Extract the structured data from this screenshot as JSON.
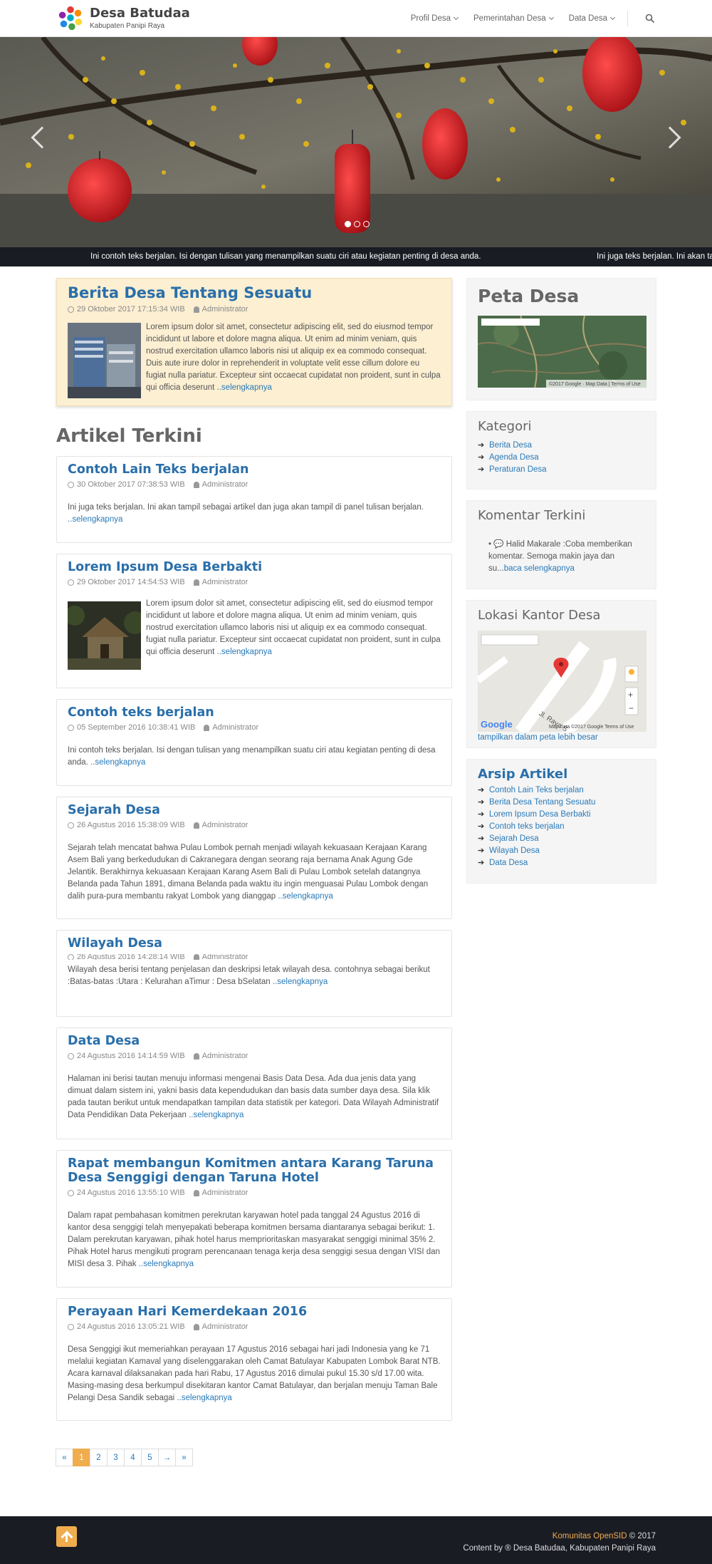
{
  "header": {
    "title": "Desa Batudaa",
    "subtitle": "Kabupaten Panipi Raya",
    "nav": [
      {
        "label": "Profil Desa"
      },
      {
        "label": "Pemerintahan Desa"
      },
      {
        "label": "Data Desa"
      }
    ],
    "search_icon": "search-icon"
  },
  "slider": {
    "dots": 3,
    "active": 0
  },
  "ticker": {
    "text1": "Ini contoh teks berjalan. Isi dengan tulisan yang menampilkan suatu ciri atau kegiatan penting di desa anda.",
    "text2": "Ini juga teks berjalan. Ini akan tampil sebagai artikel dan juga akan tampil di panel tulisan berjalan."
  },
  "featured": {
    "title": "Berita Desa Tentang Sesuatu",
    "date": "29 Oktober 2017 17:15:34 WIB",
    "author": "Administrator",
    "excerpt": "Lorem ipsum dolor sit amet, consectetur adipiscing elit, sed do eiusmod tempor incididunt ut labore et dolore magna aliqua. Ut enim ad minim veniam, quis nostrud exercitation ullamco laboris nisi ut aliquip ex ea commodo consequat. Duis aute irure dolor in reprehenderit in voluptate velit esse cillum dolore eu fugiat nulla pariatur. Excepteur sint occaecat cupidatat non proident, sunt in culpa qui officia deserunt ",
    "more": "..selengkapnya"
  },
  "articles_title": "Artikel Terkini",
  "posts": [
    {
      "title": "Contoh Lain Teks berjalan",
      "date": "30 Oktober 2017 07:38:53 WIB",
      "author": "Administrator",
      "excerpt": "Ini juga teks berjalan. Ini akan tampil sebagai artikel dan juga akan tampil di panel tulisan berjalan. ",
      "more": "..selengkapnya"
    },
    {
      "title": "Lorem Ipsum Desa Berbakti",
      "date": "29 Oktober 2017 14:54:53 WIB",
      "author": "Administrator",
      "excerpt": "Lorem ipsum dolor sit amet, consectetur adipiscing elit, sed do eiusmod tempor incididunt ut labore et dolore magna aliqua. Ut enim ad minim veniam, quis nostrud exercitation ullamco laboris nisi ut aliquip ex ea commodo consequat. fugiat nulla pariatur. Excepteur sint occaecat cupidatat non proident, sunt in culpa qui officia deserunt ",
      "more": "..selengkapnya"
    },
    {
      "title": "Contoh teks berjalan",
      "date": "05 September 2016 10:38:41 WIB",
      "author": "Administrator",
      "excerpt": "Ini contoh teks berjalan. Isi dengan tulisan yang menampilkan suatu ciri atau kegiatan penting di desa anda. ",
      "more": "..selengkapnya"
    },
    {
      "title": "Sejarah Desa",
      "date": "26 Agustus 2016 15:38:09 WIB",
      "author": "Administrator",
      "excerpt": "Sejarah telah mencatat bahwa Pulau Lombok pernah menjadi wilayah kekuasaan Kerajaan Karang Asem Bali yang berkedudukan di Cakranegara dengan seorang raja bernama Anak Agung Gde Jelantik. Berakhirnya kekuasaan Kerajaan Karang Asem Bali di Pulau Lombok setelah datangnya Belanda pada Tahun 1891, dimana Belanda pada waktu itu ingin menguasai Pulau Lombok dengan dalih pura-pura membantu rakyat Lombok yang dianggap ",
      "more": "..selengkapnya"
    },
    {
      "title": "Wilayah Desa",
      "date": "26 Agustus 2016 14:28:14 WIB",
      "author": "Administrator",
      "excerpt": "Wilayah desa berisi tentang penjelasan dan deskripsi letak wilayah desa. contohnya sebagai berikut :Batas-batas :Utara : Kelurahan aTimur : Desa bSelatan ",
      "more": "..selengkapnya"
    },
    {
      "title": "Data Desa",
      "date": "24 Agustus 2016 14:14:59 WIB",
      "author": "Administrator",
      "excerpt": "Halaman ini berisi tautan menuju informasi mengenai Basis Data Desa. Ada dua jenis data yang dimuat dalam sistem ini, yakni basis data kependudukan dan basis data sumber daya desa. Sila klik pada tautan berikut untuk mendapatkan tampilan data statistik per kategori. Data Wilayah Administratif Data Pendidikan Data Pekerjaan ",
      "more": "..selengkapnya"
    },
    {
      "title": "Rapat membangun Komitmen antara Karang Taruna Desa Senggigi dengan Taruna Hotel",
      "date": "24 Agustus 2016 13:55:10 WIB",
      "author": "Administrator",
      "excerpt": "Dalam rapat pembahasan komitmen perekrutan karyawan hotel pada tanggal 24 Agustus 2016 di kantor desa senggigi telah menyepakati beberapa komitmen bersama diantaranya sebagai berikut: 1. Dalam perekrutan karyawan, pihak hotel harus memprioritaskan masyarakat senggigi minimal 35% 2. Pihak Hotel harus mengikuti program perencanaan tenaga kerja desa senggigi sesua dengan VISI dan MISI desa 3. Pihak ",
      "more": "..selengkapnya"
    },
    {
      "title": "Perayaan Hari Kemerdekaan 2016",
      "date": "24 Agustus 2016 13:05:21 WIB",
      "author": "Administrator",
      "excerpt": "Desa Senggigi ikut memeriahkan perayaan 17 Agustus 2016 sebagai hari jadi Indonesia yang ke 71 melalui kegiatan Kamaval yang diselenggarakan oleh Camat Batulayar Kabupaten Lombok Barat NTB. Acara karnaval dilaksanakan pada hari Rabu, 17 Agustus 2016 dimulai pukul 15.30 s/d 17.00 wita. Masing-masing desa berkumpul disekitaran kantor Camat Batulayar, dan berjalan menuju Taman Bale Pelangi Desa Sandik sebagai ",
      "more": "..selengkapnya"
    }
  ],
  "pagination": [
    "«",
    "1",
    "2",
    "3",
    "4",
    "5",
    "→",
    "»"
  ],
  "sidebar": {
    "peta_title": "Peta Desa",
    "peta_credit": "©2017 Google · Map Data | Terms of Use",
    "kategori_title": "Kategori",
    "kategori": [
      "Berita Desa",
      "Agenda Desa",
      "Peraturan Desa"
    ],
    "komentar_title": "Komentar Terkini",
    "komentar_text": "Halid Makarale :Coba memberikan komentar. Semoga makin jaya dan su...",
    "komentar_link": "baca selengkapnya",
    "lokasi_title": "Lokasi Kantor Desa",
    "lokasi_road": "Jl. Raya S",
    "lokasi_credit": "Map data ©2017 Google   Terms of Use",
    "lokasi_link": "tampilkan dalam peta lebih besar",
    "arsip_title": "Arsip Artikel",
    "arsip": [
      "Contoh Lain Teks berjalan",
      "Berita Desa Tentang Sesuatu",
      "Lorem Ipsum Desa Berbakti",
      "Contoh teks berjalan",
      "Sejarah Desa",
      "Wilayah Desa",
      "Data Desa"
    ]
  },
  "footer": {
    "brand": "Komunitas OpenSID",
    "year": " © 2017",
    "content": "Content by ® Desa Batudaa, Kabupaten Panipi Raya"
  }
}
